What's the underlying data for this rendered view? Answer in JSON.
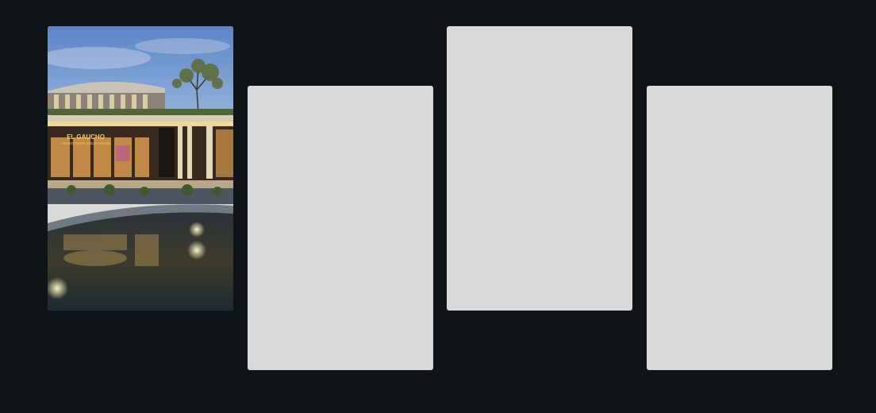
{
  "gallery": {
    "cards": [
      {
        "kind": "photo",
        "sign_line1": "EL GAUCHO",
        "sign_line2": "ARGENTINIAN STEAKHOUSE"
      },
      {
        "kind": "placeholder"
      },
      {
        "kind": "placeholder"
      },
      {
        "kind": "placeholder"
      }
    ]
  },
  "colors": {
    "background": "#0e1418",
    "placeholder": "#d9d9d9",
    "sign": "#f3c86a"
  }
}
